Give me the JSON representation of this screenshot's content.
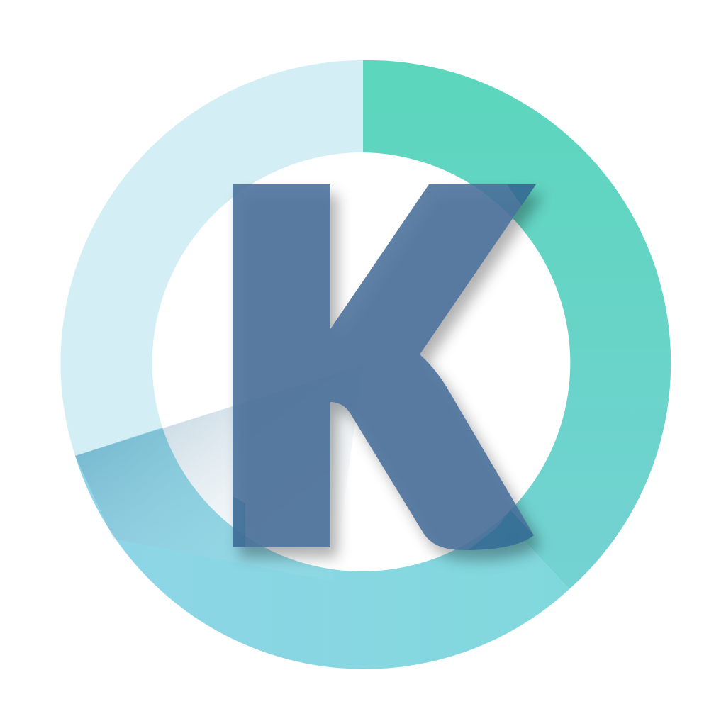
{
  "logo": {
    "name": "k-ring-app-icon",
    "letter": "K",
    "colors": {
      "background": "#ffffff",
      "ring_light": "#d3eef4",
      "ring_green_top": "#5bd6bc",
      "ring_green_bottom": "#74d2d3",
      "ring_blue_left": "#8fd5e8",
      "ring_blue_right": "#80d8dc",
      "letter": "#4a6f9a",
      "letter_overlap": "#2a6e92",
      "wedge_overlay": "#2a7ea4"
    }
  }
}
